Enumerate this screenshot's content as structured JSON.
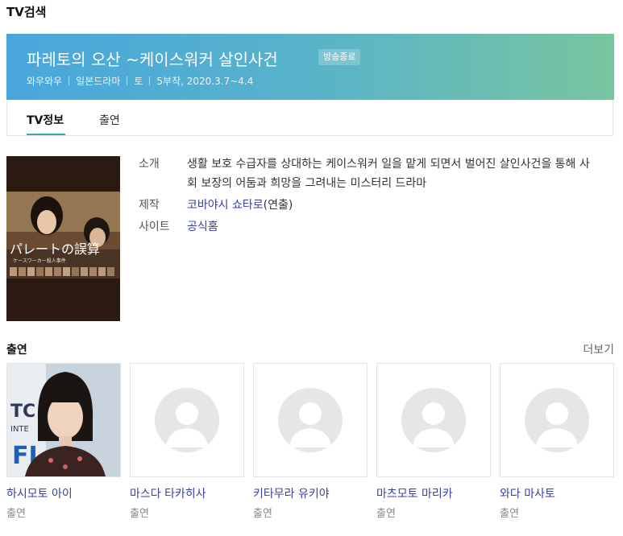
{
  "page": {
    "section_title": "TV검색"
  },
  "show": {
    "title": "파레토의 오산 ~케이스워커 살인사건",
    "badge": "방송종료",
    "channel": "와우와우",
    "genre": "일본드라마",
    "day": "토",
    "schedule": "5부작, 2020.3.7~4.4"
  },
  "tabs": [
    {
      "label": "TV정보",
      "active": true
    },
    {
      "label": "출연",
      "active": false
    }
  ],
  "poster": {
    "title_text": "パレートの誤算",
    "subtitle_text": "ケースワーカー殺人事件"
  },
  "info": {
    "intro_label": "소개",
    "intro_text": "생활 보호 수급자를 상대하는 케이스워커 일을 맡게 되면서 벌어진 살인사건을 통해 사회 보장의 어둠과 희망을 그려내는 미스터리 드라마",
    "production_label": "제작",
    "director_name": "코바야시 쇼타로",
    "director_role": "(연출)",
    "site_label": "사이트",
    "site_link": "공식홈"
  },
  "cast": {
    "heading": "출연",
    "more_label": "더보기",
    "members": [
      {
        "name": "하시모토 아이",
        "role": "출연",
        "has_photo": true
      },
      {
        "name": "마스다 타카히사",
        "role": "출연",
        "has_photo": false
      },
      {
        "name": "키타무라 유키야",
        "role": "출연",
        "has_photo": false
      },
      {
        "name": "마츠모토 마리카",
        "role": "출연",
        "has_photo": false
      },
      {
        "name": "와다 마사토",
        "role": "출연",
        "has_photo": false
      }
    ]
  },
  "colors": {
    "banner_start": "#49a6dd",
    "banner_end": "#78c5a0",
    "link": "#3b3fa5",
    "tab_active_underline": "#39a6b8"
  }
}
